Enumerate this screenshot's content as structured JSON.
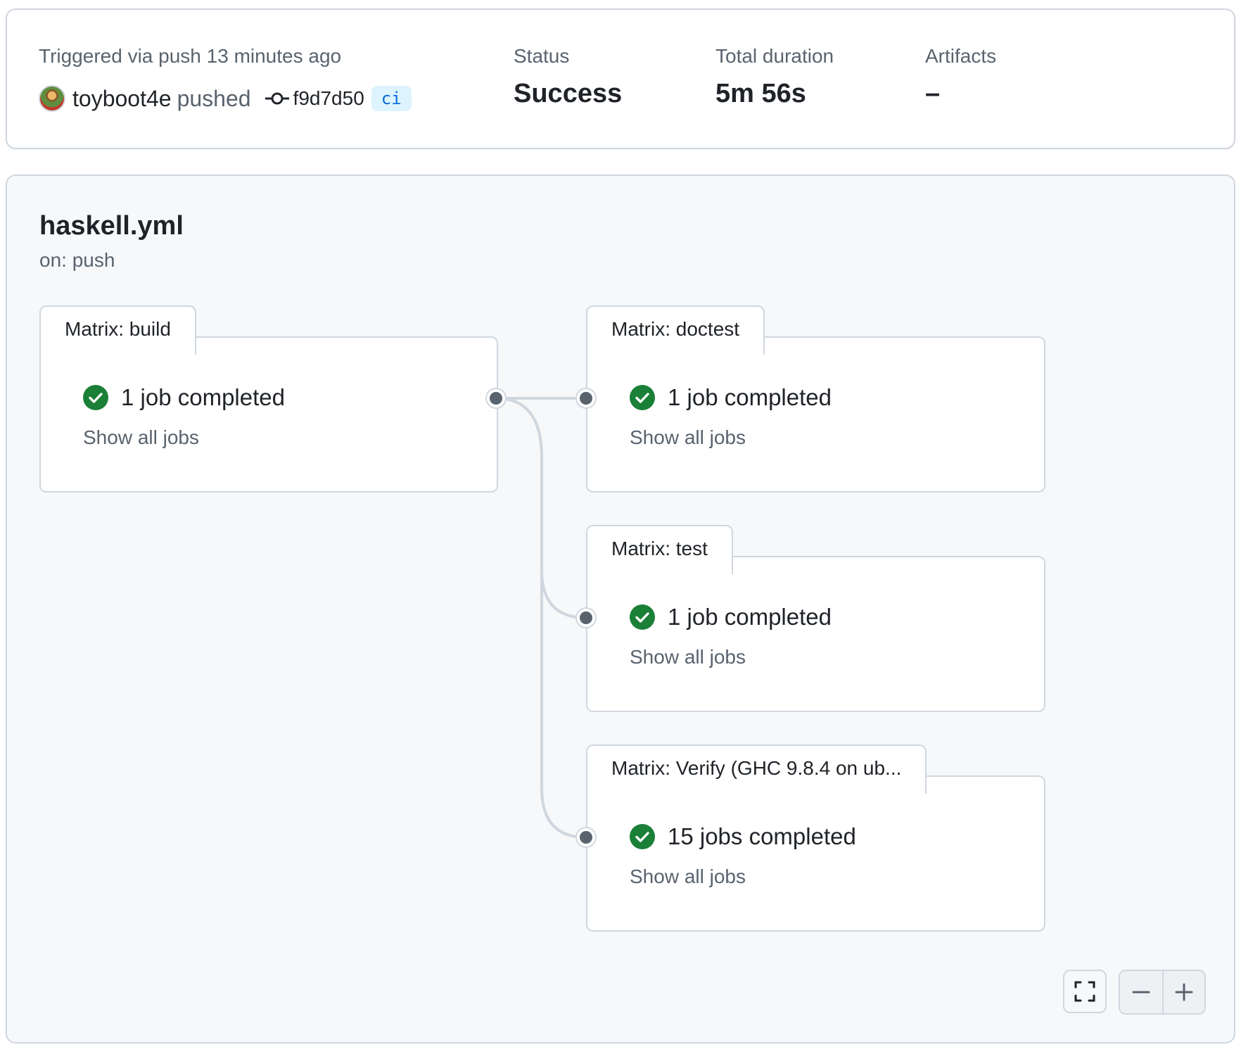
{
  "summary": {
    "trigger_label": "Triggered via push 13 minutes ago",
    "actor": "toyboot4e",
    "action": "pushed",
    "commit_sha": "f9d7d50",
    "branch": "ci",
    "status_label": "Status",
    "status_value": "Success",
    "duration_label": "Total duration",
    "duration_value": "5m 56s",
    "artifacts_label": "Artifacts",
    "artifacts_value": "–"
  },
  "workflow": {
    "file": "haskell.yml",
    "trigger": "on: push"
  },
  "jobs": [
    {
      "name": "Matrix: build",
      "status_text": "1 job completed",
      "link": "Show all jobs"
    },
    {
      "name": "Matrix: doctest",
      "status_text": "1 job completed",
      "link": "Show all jobs"
    },
    {
      "name": "Matrix: test",
      "status_text": "1 job completed",
      "link": "Show all jobs"
    },
    {
      "name": "Matrix: Verify (GHC 9.8.4 on ub...",
      "status_text": "15 jobs completed",
      "link": "Show all jobs"
    }
  ],
  "colors": {
    "success": "#1a7f37",
    "border": "#d0d7de",
    "muted": "#59636e",
    "accent": "#0969da"
  },
  "icons": {
    "commit": "git-commit-icon",
    "success": "check-circle-fill-icon",
    "fullscreen": "screen-full-icon",
    "zoom_out": "dash-icon",
    "zoom_in": "plus-icon"
  }
}
